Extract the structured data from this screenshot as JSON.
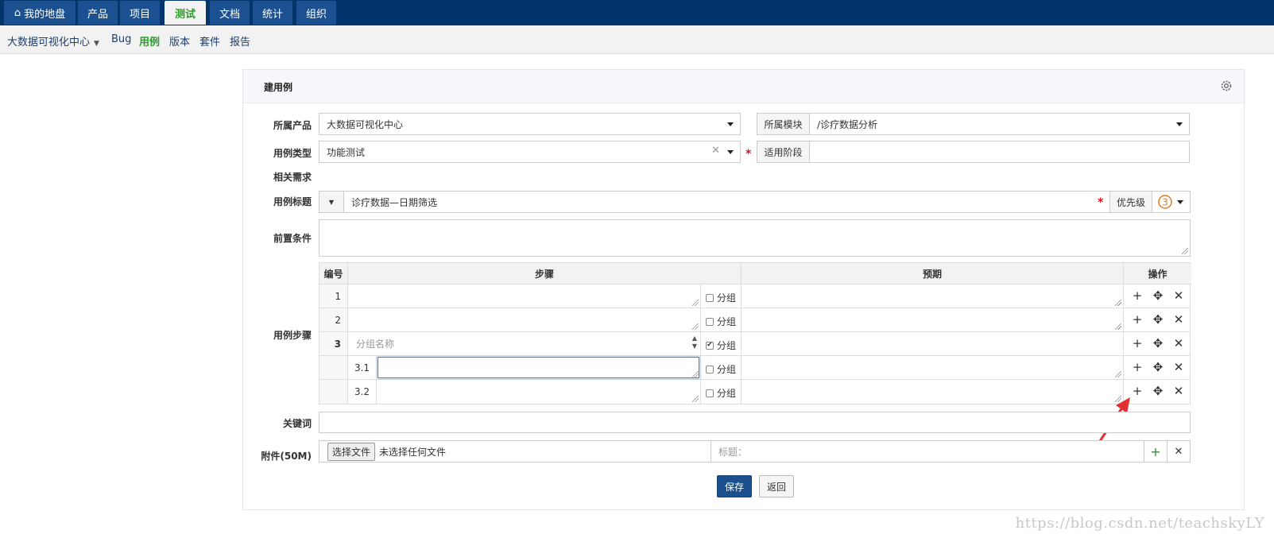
{
  "topnav": {
    "tabs": [
      {
        "label": "我的地盘",
        "active": false
      },
      {
        "label": "产品",
        "active": false
      },
      {
        "label": "项目",
        "active": false
      },
      {
        "label": "测试",
        "active": true
      },
      {
        "label": "文档",
        "active": false
      },
      {
        "label": "统计",
        "active": false
      },
      {
        "label": "组织",
        "active": false
      }
    ]
  },
  "subnav": {
    "product": "大数据可视化中心",
    "items": [
      "Bug",
      "用例",
      "版本",
      "套件",
      "报告"
    ]
  },
  "panel": {
    "title": "建用例"
  },
  "form": {
    "product_label": "所属产品",
    "product_value": "大数据可视化中心",
    "module_label": "所属模块",
    "module_value": "/诊疗数据分析",
    "type_label": "用例类型",
    "type_value": "功能测试",
    "stage_label": "适用阶段",
    "stage_value": "",
    "story_label": "相关需求",
    "title_label": "用例标题",
    "title_value": "诊疗数据—日期筛选",
    "priority_label": "优先级",
    "priority_value": "3",
    "precondition_label": "前置条件",
    "steps_label": "用例步骤",
    "keywords_label": "关键词",
    "attach_label": "附件(50M)",
    "choose_file": "选择文件",
    "no_file": "未选择任何文件",
    "attach_title_placeholder": "标题：",
    "required_mark": "*"
  },
  "steps": {
    "headers": {
      "num": "编号",
      "step": "步骤",
      "expect": "预期",
      "ops": "操作"
    },
    "group_label": "分组",
    "group_name_placeholder": "分组名称",
    "rows": [
      {
        "num": "1",
        "group": false
      },
      {
        "num": "2",
        "group": false
      },
      {
        "num": "3",
        "group": true
      },
      {
        "num": "3.1",
        "group": false
      },
      {
        "num": "3.2",
        "group": false
      }
    ]
  },
  "buttons": {
    "save": "保存",
    "back": "返回"
  },
  "icons": {
    "add": "+",
    "move": "✥",
    "delete": "✕"
  },
  "watermark": "https://blog.csdn.net/teachskyLY",
  "colors": {
    "topnav_bg": "#03356d",
    "tab_bg": "#1c5191",
    "active_green": "#2a9d2a",
    "save_bg": "#1a4f8b",
    "required": "#d9141b",
    "arrow": "#e33030"
  }
}
